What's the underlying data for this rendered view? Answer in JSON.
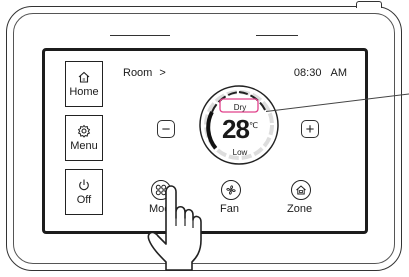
{
  "header": {
    "room_label": "Room",
    "chevron": ">",
    "time": "08:30",
    "ampm": "AM"
  },
  "sidebar": {
    "items": [
      {
        "label": "Home",
        "icon": "home-icon"
      },
      {
        "label": "Menu",
        "icon": "gear-icon"
      },
      {
        "label": "Off",
        "icon": "power-icon"
      }
    ]
  },
  "thermostat": {
    "mode": "Dry",
    "temperature": "28",
    "unit": "℃",
    "fan_speed": "Low",
    "mode_highlight_color": "#e0408a"
  },
  "controls": {
    "minus": "−",
    "plus": "+"
  },
  "bottom_nav": {
    "mode_label": "Mode",
    "fan_label": "Fan",
    "zone_label": "Zone"
  }
}
